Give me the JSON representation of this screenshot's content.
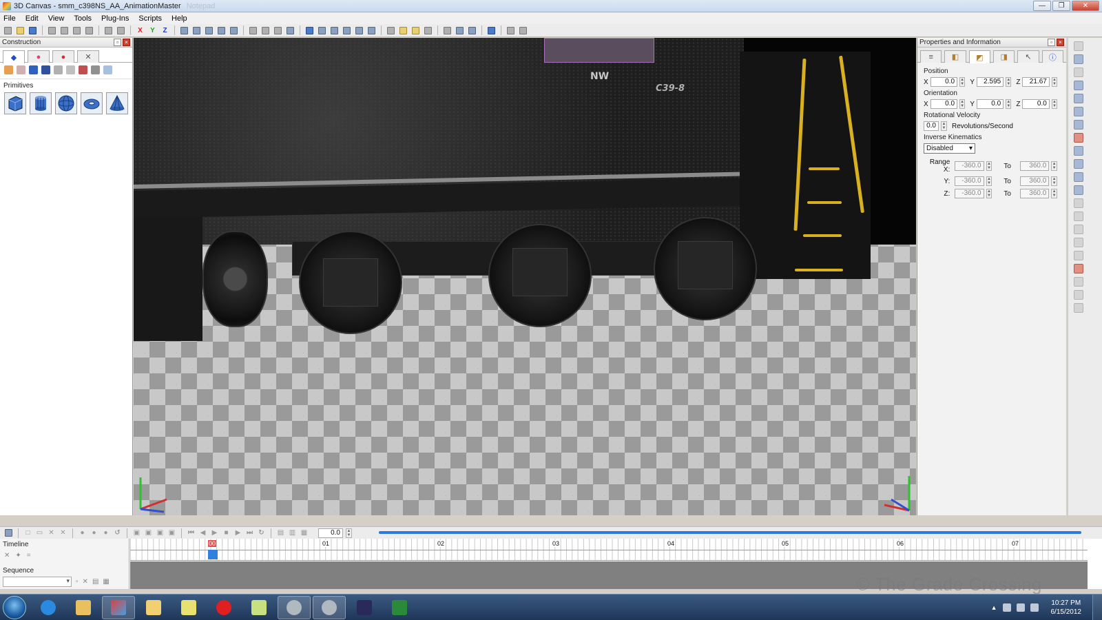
{
  "window": {
    "title": "3D Canvas - smm_c398NS_AA_AnimationMaster",
    "ghost_title": "Notepad",
    "controls": {
      "minimize": "—",
      "maximize": "❐",
      "close": "✕"
    }
  },
  "menu": [
    "File",
    "Edit",
    "View",
    "Tools",
    "Plug-Ins",
    "Scripts",
    "Help"
  ],
  "toolbar": {
    "axis_x": "X",
    "axis_y": "Y",
    "axis_z": "Z"
  },
  "construction": {
    "title": "Construction",
    "primitives_label": "Primitives",
    "primitives": [
      "cube",
      "cylinder",
      "sphere",
      "torus",
      "cone"
    ]
  },
  "viewport": {
    "road_name": "NW",
    "model": "C39-8",
    "watermark": "© The Grade Crossing"
  },
  "properties": {
    "title": "Properties and Information",
    "position_label": "Position",
    "position": {
      "x": "0.0",
      "y": "2.595",
      "z": "21.67"
    },
    "orientation_label": "Orientation",
    "orientation": {
      "x": "0.0",
      "y": "0.0",
      "z": "0.0"
    },
    "rot_velocity_label": "Rotational Velocity",
    "rot_velocity": "0.0",
    "rot_velocity_unit": "Revolutions/Second",
    "ik_label": "Inverse Kinematics",
    "ik_value": "Disabled",
    "range_x_label": "Range X:",
    "range_y_label": "Y:",
    "range_z_label": "Z:",
    "to_label": "To",
    "range_min": "-360.0",
    "range_max": "360.0",
    "axis_labels": {
      "x": "X",
      "y": "Y",
      "z": "Z"
    }
  },
  "animation": {
    "time_value": "0.0",
    "timeline_label": "Timeline",
    "sequence_label": "Sequence",
    "markers": [
      "00",
      "01",
      "02",
      "03",
      "04",
      "05",
      "06",
      "07"
    ]
  },
  "taskbar": {
    "time": "10:27 PM",
    "date": "6/15/2012"
  },
  "colors": {
    "accent": "#2a78e0",
    "handrail": "#d8b020",
    "cursor_marker": "#e05050"
  }
}
